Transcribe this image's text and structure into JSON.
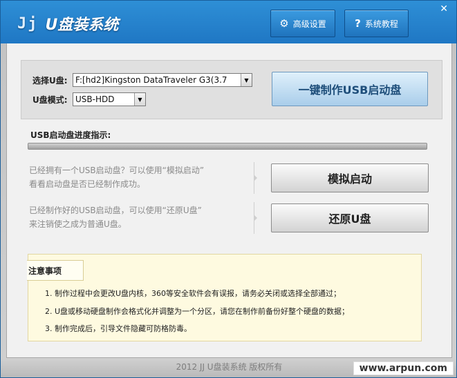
{
  "app": {
    "logo_mark": "Jj",
    "title": "U盘装系统"
  },
  "header": {
    "advanced_settings": "高级设置",
    "advanced_icon": "gear-icon",
    "tutorial": "系统教程",
    "tutorial_icon": "question-icon",
    "close_glyph": "✕"
  },
  "form": {
    "disk_label": "选择U盘:",
    "disk_value": "F:[hd2]Kingston DataTraveler G3(3.7",
    "mode_label": "U盘模式:",
    "mode_value": "USB-HDD"
  },
  "buttons": {
    "make": "一键制作USB启动盘",
    "simulate": "模拟启动",
    "restore": "还原U盘"
  },
  "progress": {
    "label": "USB启动盘进度指示:",
    "value_percent": 0
  },
  "hints": {
    "simulate_line1": "已经拥有一个USB启动盘？可以使用“模拟启动”",
    "simulate_line2": "看看启动盘是否已经制作成功。",
    "restore_line1": "已经制作好的USB启动盘，可以使用“还原U盘”",
    "restore_line2": "来注销使之成为普通U盘。"
  },
  "notes": {
    "title": "注意事项",
    "items": [
      "1. 制作过程中会更改U盘内核，360等安全软件会有误报，请务必关闭或选择全部通过；",
      "2. U盘或移动硬盘制作会格式化并调整为一个分区，请您在制作前备份好整个硬盘的数据；",
      "3. 制作完成后，引导文件隐藏可防格防毒。"
    ]
  },
  "footer": {
    "copyright": "2012 JJ U盘装系统 版权所有",
    "watermark": "www.arpun.com"
  },
  "colors": {
    "header_blue": "#1f77c4",
    "make_button": "#a9cdea",
    "notes_bg": "#fefae0"
  }
}
